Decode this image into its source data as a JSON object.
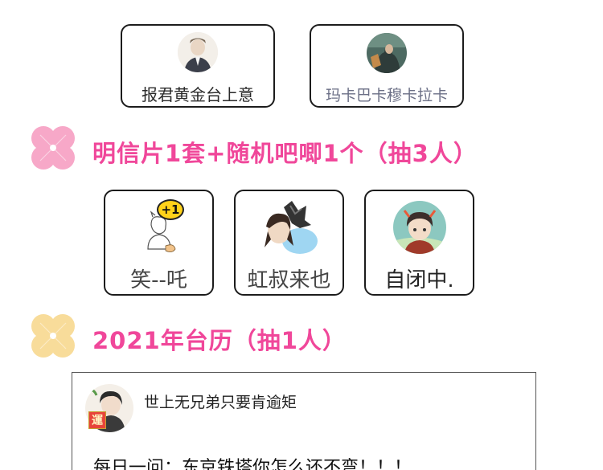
{
  "tier_a": {
    "winners": [
      {
        "name": "报君黄金台上意",
        "color": "#2a2a2a"
      },
      {
        "name": "玛卡巴卡穆卡拉卡",
        "color": "#6b6f86"
      }
    ]
  },
  "tier_b": {
    "title": "明信片1套+随机吧唧1个（抽3人）",
    "winners": [
      {
        "name": "笑--吒",
        "badge": "+1"
      },
      {
        "name": "虹叔来也"
      },
      {
        "name": "自闭中."
      }
    ]
  },
  "tier_c": {
    "title": "2021年台历（抽1人）"
  },
  "comment": {
    "username": "世上无兄弟只要肯逾矩",
    "avatar_tag": "運",
    "text": "每日一问：东京铁塔你怎么还不弯！！！"
  },
  "colors": {
    "title_pink": "#f0479a",
    "clover_teal": "#8fd8cf",
    "clover_pink": "#f7a8c8",
    "clover_yellow": "#f8dc9a",
    "card_border": "#1c1c1c"
  }
}
